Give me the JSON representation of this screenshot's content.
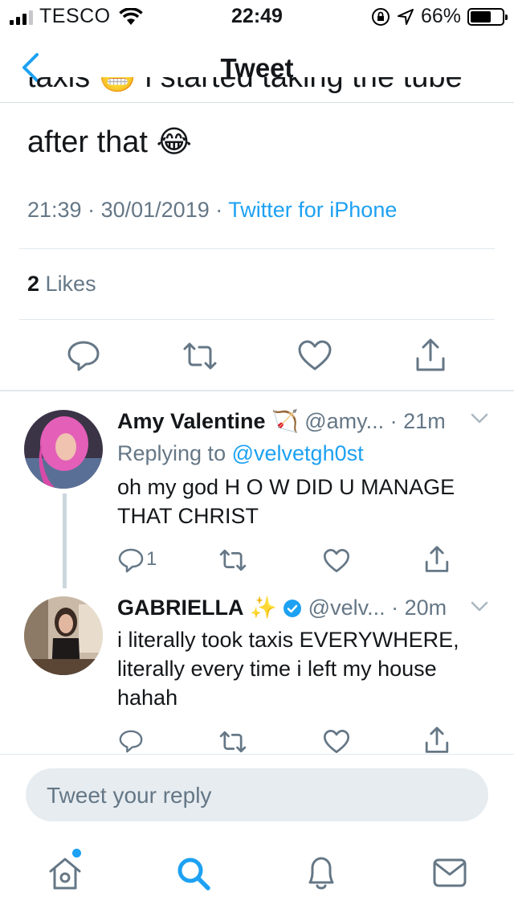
{
  "status_bar": {
    "carrier": "TESCO",
    "time": "22:49",
    "battery": "66%",
    "battery_level": 0.66
  },
  "nav": {
    "title": "Tweet"
  },
  "tweet": {
    "text_cut": "taxis 😬 i started taking the tube",
    "text_line": "after that 😂",
    "time": "21:39",
    "date": "30/01/2019",
    "source": "Twitter for iPhone",
    "likes_count": "2",
    "likes_label": "Likes"
  },
  "replies": [
    {
      "name": "Amy Valentine",
      "name_emoji": "🏹",
      "handle": "@amy...",
      "time": "· 21m",
      "replying_prefix": "Replying to",
      "replying_to": "@velvetgh0st",
      "text_line1": "oh my god H O W DID U MANAGE",
      "text_line2": "THAT CHRIST",
      "reply_count": "1"
    },
    {
      "name": "GABRIELLA",
      "name_emoji": "✨",
      "handle": "@velv...",
      "time": "· 20m",
      "text_line1": "i literally took taxis EVERYWHERE,",
      "text_line2": "literally every time i left my house",
      "text_line3": "hahah"
    }
  ],
  "compose": {
    "placeholder": "Tweet your reply"
  },
  "colors": {
    "accent": "#1da1f2",
    "secondary_text": "#657786",
    "divider": "#e1e8ed"
  }
}
